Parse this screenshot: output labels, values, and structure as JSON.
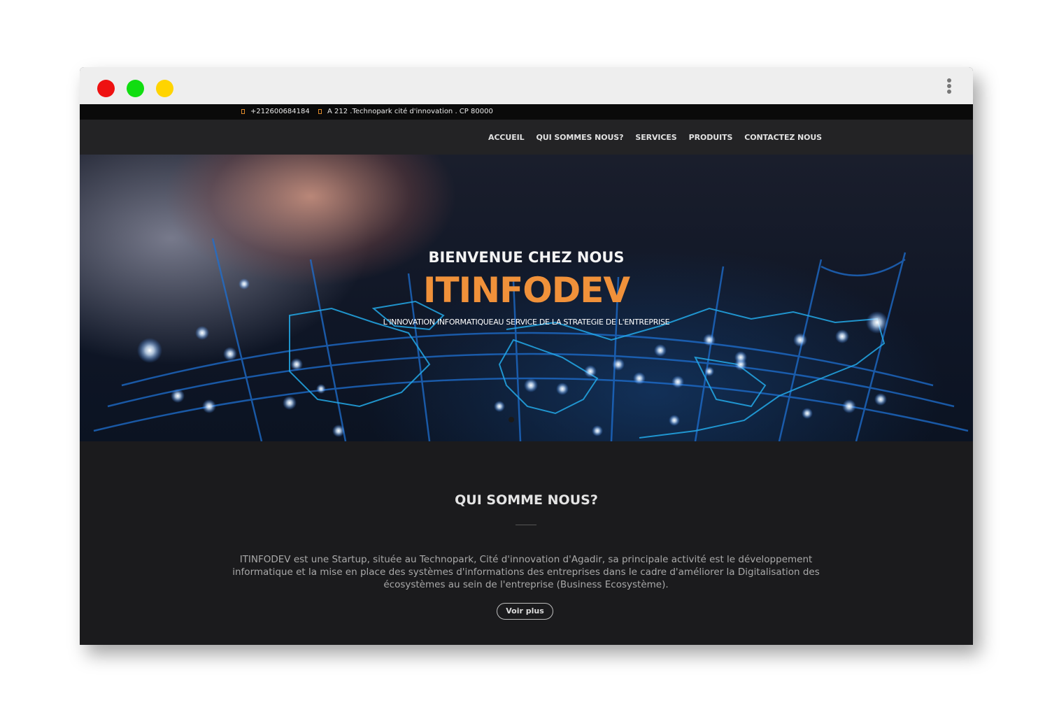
{
  "window": {
    "controls": [
      "close",
      "minimize",
      "maximize"
    ],
    "menu_icon": "kebab-menu-icon"
  },
  "topbar": {
    "phone": "+212600684184",
    "address": "A 212 .Technopark cité d'innovation . CP 80000",
    "icon_color": "#e08a2a"
  },
  "nav": {
    "items": [
      "ACCUEIL",
      "QUI SOMMES NOUS?",
      "SERVICES",
      "PRODUITS",
      "CONTACTEZ NOUS"
    ]
  },
  "hero": {
    "welcome": "BIENVENUE CHEZ NOUS",
    "brand": "ITINFODEV",
    "brand_color": "#f0913a",
    "tagline": "L'INNOVATION INFORMATIQUEAU SERVICE DE LA STRATEGIE DE L'ENTREPRISE"
  },
  "about": {
    "title": "QUI SOMME NOUS?",
    "text": "ITINFODEV est une Startup, située au Technopark, Cité d'innovation d'Agadir, sa principale activité est le développement informatique et la mise en place des systèmes d'informations des entreprises dans le cadre d'améliorer la Digitalisation des écosystèmes au sein de l'entreprise (Business Ecosystème).",
    "button": "Voir plus"
  }
}
